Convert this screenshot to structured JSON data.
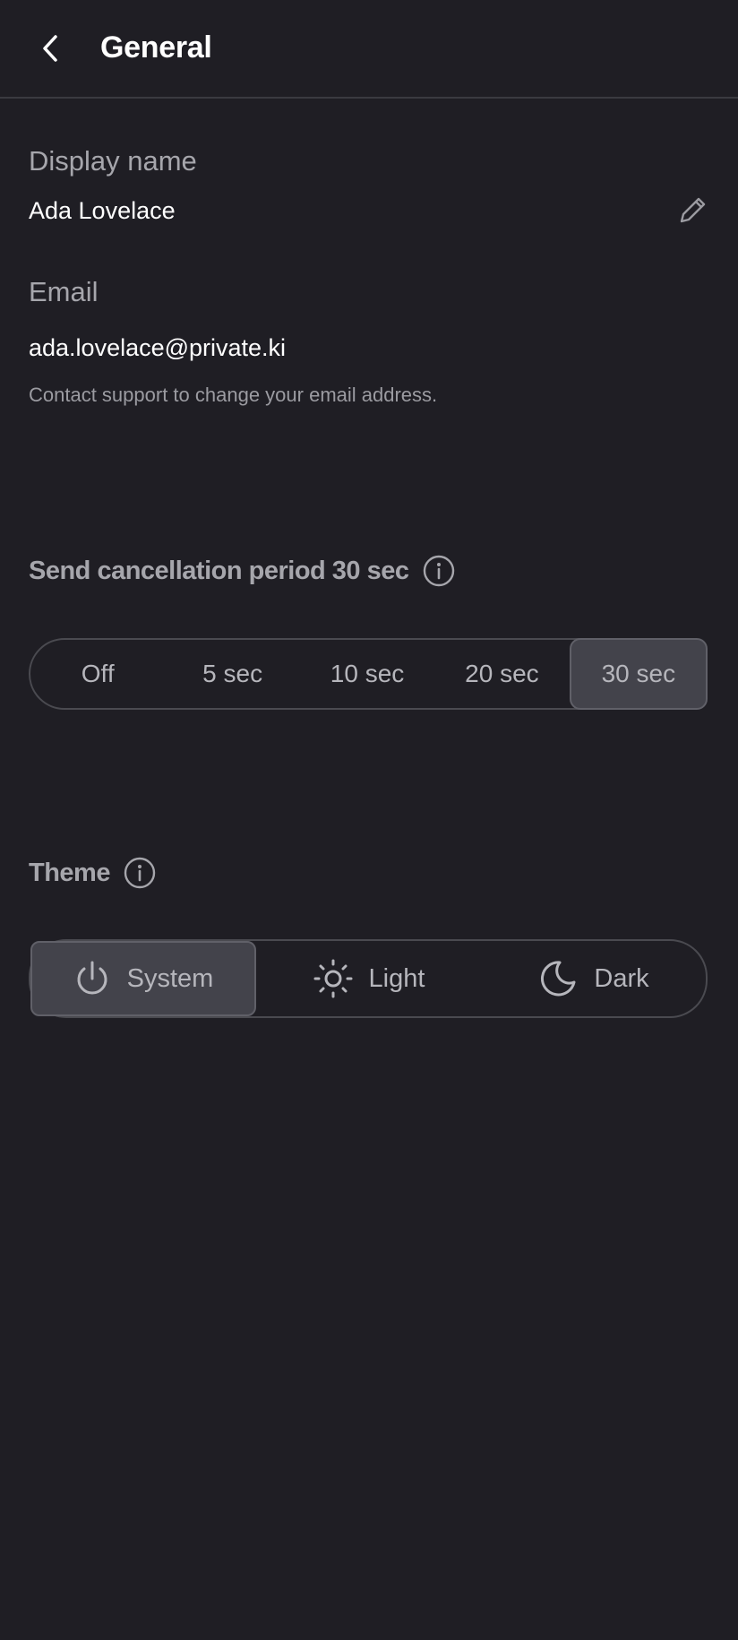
{
  "header": {
    "title": "General",
    "back_icon": "chevron-left-icon"
  },
  "display_name": {
    "label": "Display name",
    "value": "Ada Lovelace",
    "edit_icon": "pencil-icon"
  },
  "email": {
    "label": "Email",
    "value": "ada.lovelace@private.ki",
    "help": "Contact support to change your email address."
  },
  "cancellation": {
    "title": "Send cancellation period 30 sec",
    "info_icon": "info-icon",
    "options": [
      "Off",
      "5 sec",
      "10 sec",
      "20 sec",
      "30 sec"
    ],
    "selected": "30 sec"
  },
  "theme": {
    "title": "Theme",
    "info_icon": "info-icon",
    "options": [
      {
        "label": "System",
        "icon": "power-icon"
      },
      {
        "label": "Light",
        "icon": "sun-icon"
      },
      {
        "label": "Dark",
        "icon": "moon-icon"
      }
    ],
    "selected": "System"
  },
  "colors": {
    "background": "#1f1e24",
    "selected_segment": "#43434b",
    "muted_text": "#a6a6ac",
    "primary_text": "#ffffff"
  }
}
